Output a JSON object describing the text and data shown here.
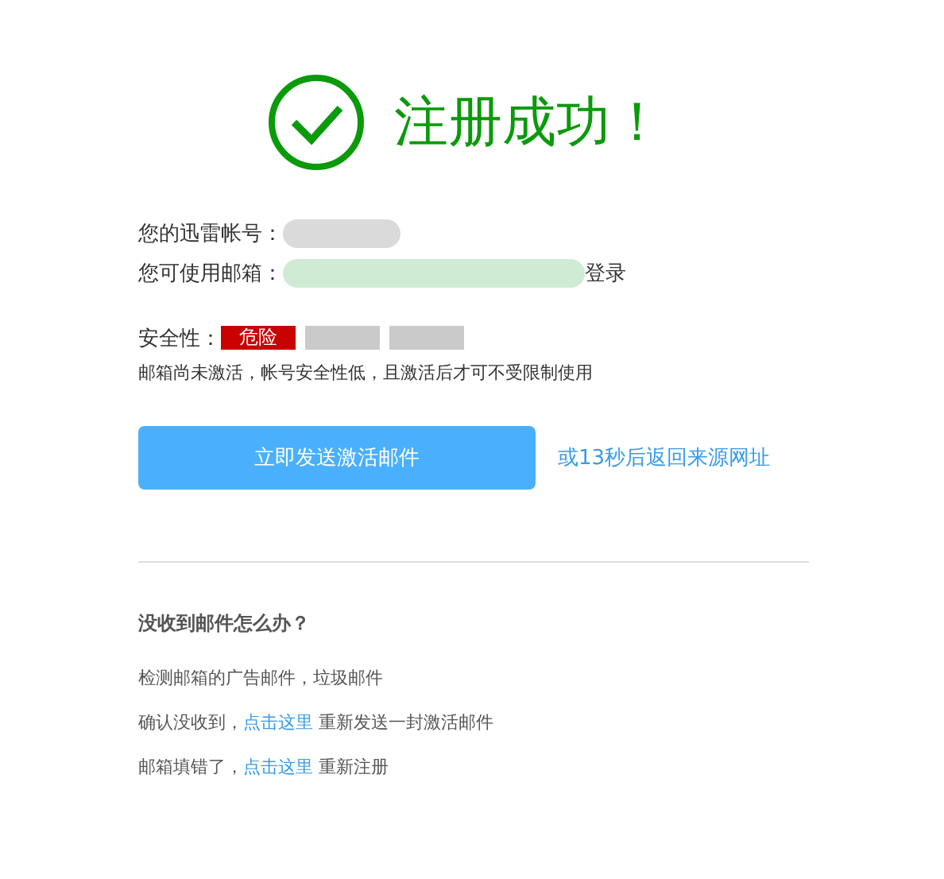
{
  "header": {
    "title": "注册成功！"
  },
  "account": {
    "label": "您的迅雷帐号："
  },
  "email": {
    "label": "您可使用邮箱：",
    "login": "登录"
  },
  "security": {
    "label": "安全性：",
    "bars": [
      {
        "text": "危险",
        "on": true
      },
      {
        "on": false
      },
      {
        "on": false
      }
    ],
    "note": "邮箱尚未激活，帐号安全性低，且激活后才可不受限制使用"
  },
  "actions": {
    "button": "立即发送激活邮件",
    "link": "或13秒后返回来源网址"
  },
  "help": {
    "title": "没收到邮件怎么办？",
    "lines": [
      {
        "parts": [
          {
            "kind": "text",
            "text": "检测邮箱的广告邮件，垃圾邮件"
          }
        ]
      },
      {
        "parts": [
          {
            "kind": "text",
            "text": "确认没收到，"
          },
          {
            "kind": "link",
            "text": "点击这里"
          },
          {
            "kind": "text",
            "text": " 重新发送一封激活邮件"
          }
        ]
      },
      {
        "parts": [
          {
            "kind": "text",
            "text": "邮箱填错了，"
          },
          {
            "kind": "link",
            "text": "点击这里"
          },
          {
            "kind": "text",
            "text": " 重新注册"
          }
        ]
      }
    ]
  }
}
